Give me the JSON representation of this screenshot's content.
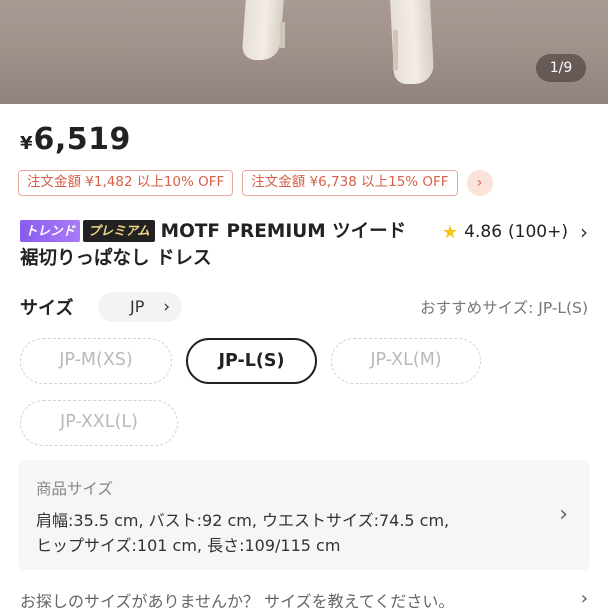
{
  "hero": {
    "pager": "1/9"
  },
  "price": {
    "currency": "¥",
    "amount": "6,519"
  },
  "coupons": [
    "注文金額 ¥1,482 以上10% OFF",
    "注文金額 ¥6,738 以上15% OFF"
  ],
  "product": {
    "badge_trend": "トレンド",
    "badge_premium": "プレミアム",
    "title": "MOTF PREMIUM ツイード 裾切りっぱなし ドレス",
    "rating": "4.86",
    "review_count": "(100+)"
  },
  "size": {
    "label": "サイズ",
    "unit": "JP",
    "recommended": "おすすめサイズ: JP-L(S)",
    "options": [
      "JP-M(XS)",
      "JP-L(S)",
      "JP-XL(M)",
      "JP-XXL(L)"
    ],
    "selected": "JP-L(S)"
  },
  "product_size": {
    "title": "商品サイズ",
    "line1": "肩幅:35.5 cm, バスト:92 cm, ウエストサイズ:74.5 cm,",
    "line2": "ヒップサイズ:101 cm, 長さ:109/115 cm"
  },
  "footer": {
    "text": "お探しのサイズがありませんか？ サイズを教えてください。"
  },
  "icons": {
    "star": "star-icon",
    "chevron": "chevron-right-icon"
  },
  "colors": {
    "coupon": "#d6604a",
    "trend_badge": "#8a5cf0",
    "premium_text": "#f4d58a",
    "star": "#f5c518"
  }
}
